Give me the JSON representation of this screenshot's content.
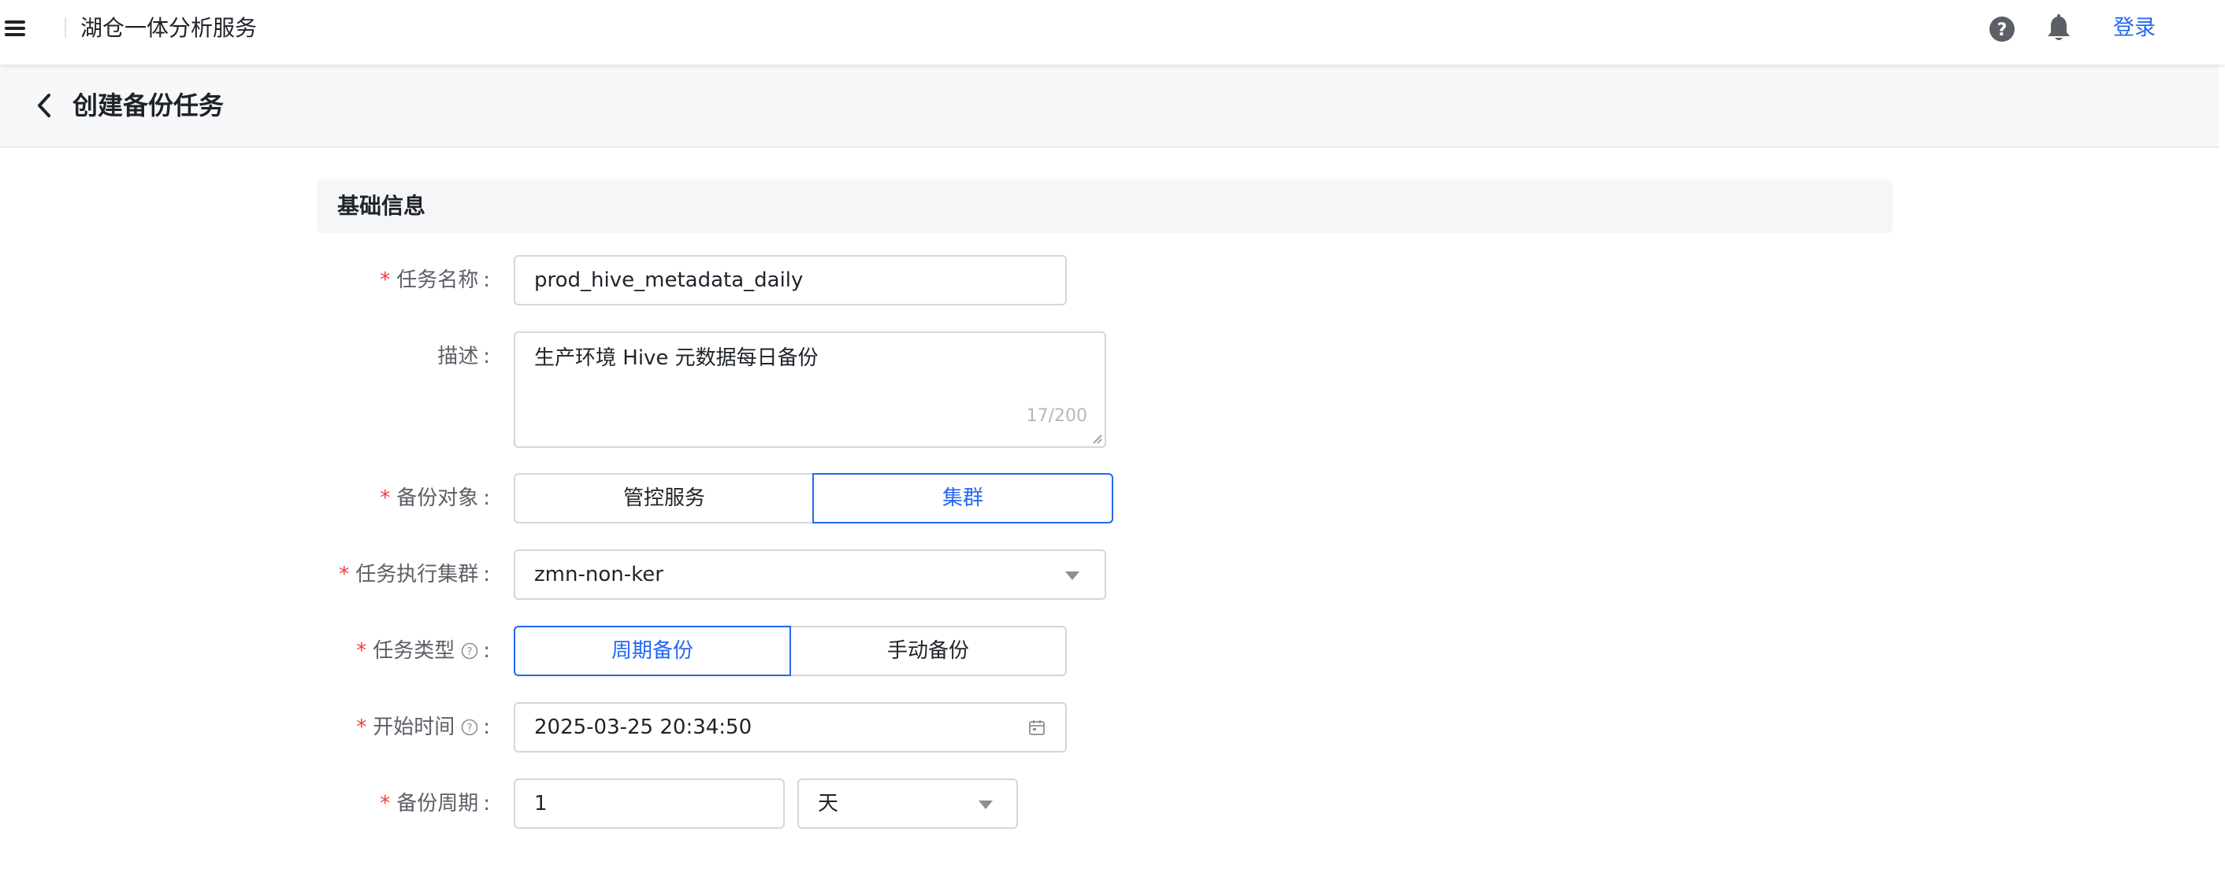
{
  "topbar": {
    "app_title": "湖仓一体分析服务",
    "login_label": "登录",
    "icons": [
      "menu-icon",
      "help-icon",
      "bell-icon"
    ]
  },
  "page": {
    "title": "创建备份任务"
  },
  "section": {
    "title": "基础信息"
  },
  "form": {
    "task_name": {
      "label": "任务名称",
      "required": true,
      "value": "prod_hive_metadata_daily"
    },
    "description": {
      "label": "描述",
      "required": false,
      "value": "生产环境 Hive 元数据每日备份",
      "counter": "17/200"
    },
    "backup_target": {
      "label": "备份对象",
      "required": true,
      "options": [
        "管控服务",
        "集群"
      ],
      "selected": "集群"
    },
    "exec_cluster": {
      "label": "任务执行集群",
      "required": true,
      "value": "zmn-non-ker"
    },
    "task_type": {
      "label": "任务类型",
      "required": true,
      "has_tip": true,
      "options": [
        "周期备份",
        "手动备份"
      ],
      "selected": "周期备份"
    },
    "start_time": {
      "label": "开始时间",
      "required": true,
      "has_tip": true,
      "value": "2025-03-25 20:34:50"
    },
    "backup_period": {
      "label": "备份周期",
      "required": true,
      "value": "1",
      "unit": "天"
    }
  },
  "colors": {
    "accent": "#2468f2",
    "required": "#f03c3c",
    "border": "#d4d6d9",
    "header_bg": "#f7f8fa"
  }
}
